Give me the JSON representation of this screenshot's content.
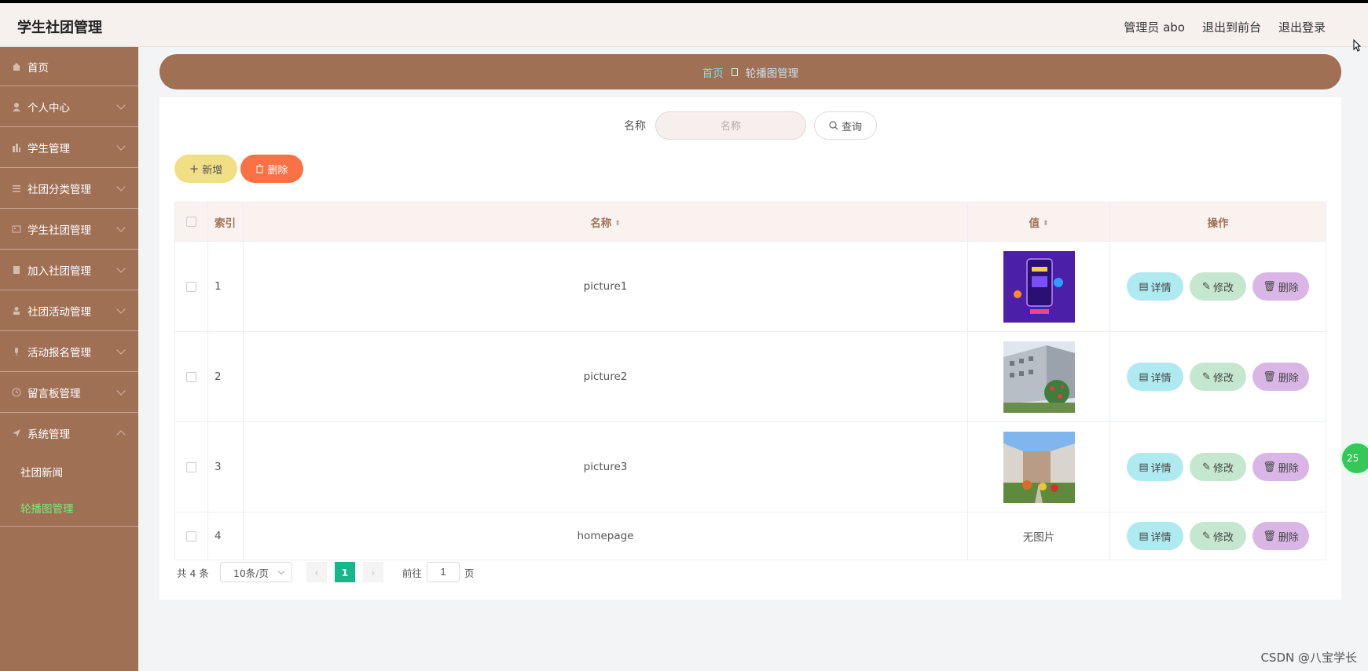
{
  "app": {
    "title": "学生社团管理"
  },
  "header": {
    "user": "管理员 abo",
    "to_front": "退出到前台",
    "logout": "退出登录"
  },
  "sidebar": {
    "home": "首页",
    "items": [
      {
        "label": "个人中心",
        "icon": "user-icon"
      },
      {
        "label": "学生管理",
        "icon": "chart-icon"
      },
      {
        "label": "社团分类管理",
        "icon": "list-icon"
      },
      {
        "label": "学生社团管理",
        "icon": "image-icon"
      },
      {
        "label": "加入社团管理",
        "icon": "doc-icon"
      },
      {
        "label": "社团活动管理",
        "icon": "person-icon"
      },
      {
        "label": "活动报名管理",
        "icon": "mic-icon"
      },
      {
        "label": "留言板管理",
        "icon": "clock-icon"
      },
      {
        "label": "系统管理",
        "icon": "send-icon"
      }
    ],
    "sub": [
      {
        "label": "社团新闻"
      },
      {
        "label": "轮播图管理"
      }
    ]
  },
  "breadcrumb": {
    "home": "首页",
    "current": "轮播图管理"
  },
  "search": {
    "label": "名称",
    "placeholder": "名称",
    "button": "查询"
  },
  "actions": {
    "add": "新增",
    "delete": "删除"
  },
  "table": {
    "columns": {
      "index": "索引",
      "name": "名称",
      "value": "值",
      "ops": "操作"
    },
    "rows": [
      {
        "index": "1",
        "name": "picture1",
        "value": ""
      },
      {
        "index": "2",
        "name": "picture2",
        "value": ""
      },
      {
        "index": "3",
        "name": "picture3",
        "value": ""
      },
      {
        "index": "4",
        "name": "homepage",
        "value": "无图片"
      }
    ],
    "ops": {
      "detail": "详情",
      "edit": "修改",
      "delete": "删除"
    }
  },
  "pagination": {
    "total": "共 4 条",
    "page_size": "10条/页",
    "current": "1",
    "goto_prefix": "前往",
    "goto_value": "1",
    "goto_suffix": "页"
  },
  "watermark": "CSDN @八宝学长",
  "badge": "25"
}
